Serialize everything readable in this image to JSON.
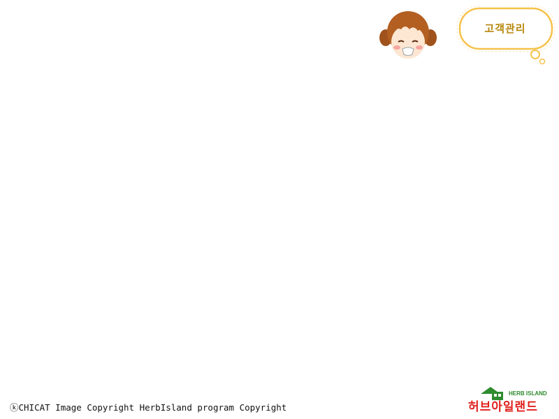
{
  "header": {
    "bubble_label": "고객관리"
  },
  "footer": {
    "copyright": "ⓚCHICAT Image Copyright HerbIsland program Copyright",
    "logo_en": "HERB ISLAND",
    "logo_ko": "허브아일랜드"
  },
  "colors": {
    "bubble_border": "#f2b21d",
    "bubble_text": "#b8860b",
    "logo_green": "#2e8b2e",
    "logo_red": "#e0201b"
  }
}
